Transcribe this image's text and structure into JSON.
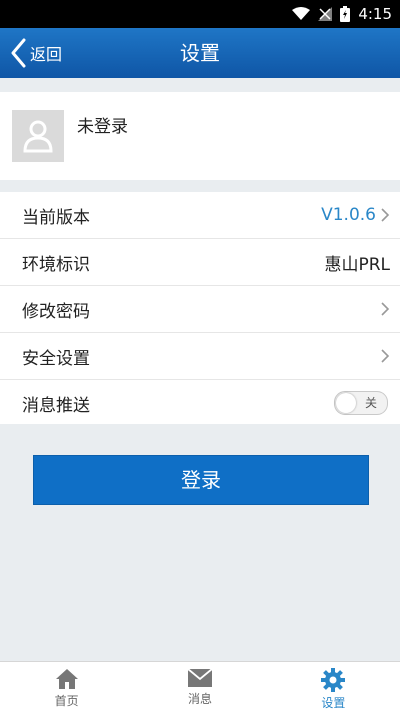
{
  "status_bar": {
    "time": "4:15",
    "icons": [
      "wifi-icon",
      "signal-icon",
      "battery-icon"
    ]
  },
  "header": {
    "back_label": "返回",
    "title": "设置"
  },
  "profile": {
    "name": "未登录",
    "avatar_icon": "person-icon"
  },
  "settings": {
    "version": {
      "label": "当前版本",
      "value": "V1.0.6"
    },
    "environment": {
      "label": "环境标识",
      "value": "惠山PRL"
    },
    "change_password": {
      "label": "修改密码"
    },
    "security": {
      "label": "安全设置"
    },
    "push": {
      "label": "消息推送",
      "toggle_label": "关",
      "enabled": false
    }
  },
  "login_button": {
    "label": "登录"
  },
  "tabbar": {
    "items": [
      {
        "label": "首页",
        "icon": "home-icon",
        "active": false
      },
      {
        "label": "消息",
        "icon": "mail-icon",
        "active": false
      },
      {
        "label": "设置",
        "icon": "gear-icon",
        "active": true
      }
    ]
  },
  "colors": {
    "primary": "#0f6fc6",
    "header": "#1565b8",
    "accent": "#2a87c8",
    "background": "#e9edf0"
  }
}
